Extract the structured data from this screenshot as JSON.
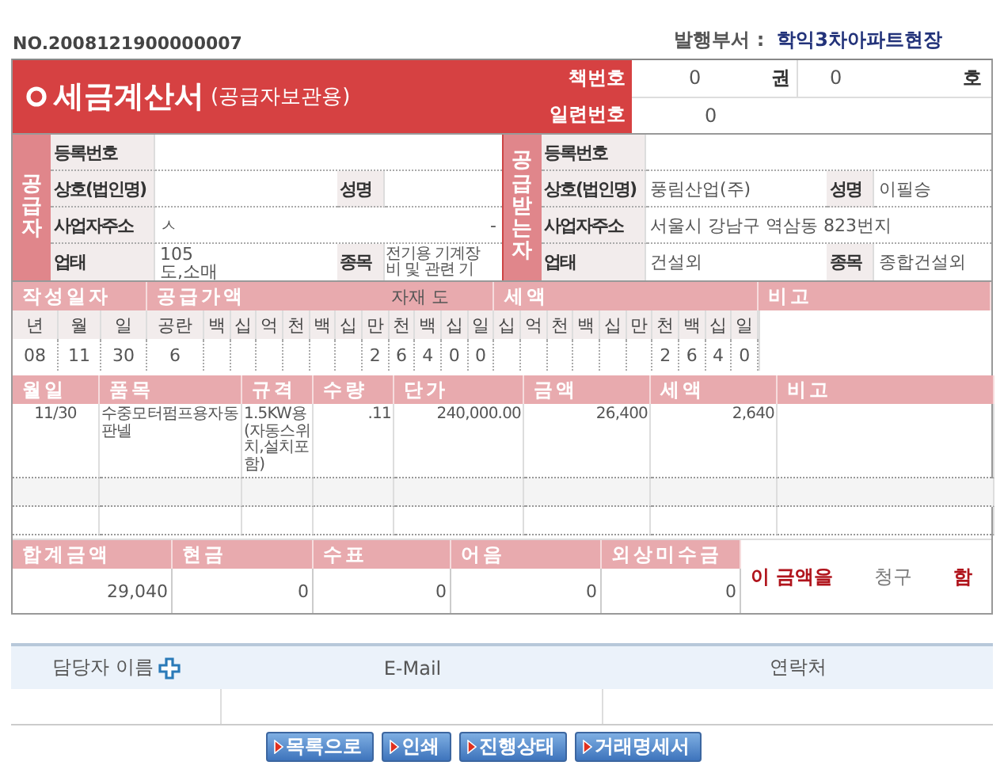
{
  "invoice_no": "NO.2008121900000007",
  "department": {
    "label": "발행부서 :",
    "value": "학익3차아파트현장"
  },
  "title": "세금계산서",
  "subtitle": "(공급자보관용)",
  "book": {
    "label": "책번호",
    "volume": "0",
    "volume_unit": "권",
    "number": "0",
    "number_unit": "호"
  },
  "serial": {
    "label": "일련번호",
    "value": "0"
  },
  "parties": [
    {
      "heading": "공급자",
      "rows": [
        {
          "label": "등록번호"
        },
        {
          "label": "상호(법인명)",
          "extra_label": "성명"
        },
        {
          "label": "사업자주소",
          "value": "ㅅ",
          "tail": "-"
        },
        {
          "label": "업태",
          "value": "105\n도,소매",
          "extra_label": "종목",
          "extra_value": "전기용 기계장\n비 및 관련 기"
        }
      ]
    },
    {
      "heading": "공급받는자",
      "rows": [
        {
          "label": "등록번호"
        },
        {
          "label": "상호(법인명)",
          "value": "풍림산업(주)",
          "extra_label": "성명",
          "extra_value": "이필승"
        },
        {
          "label": "사업자주소",
          "value": "서울시 강남구 역삼동 823번지"
        },
        {
          "label": "업태",
          "value": "건설외",
          "extra_label": "종목",
          "extra_value": "종합건설외"
        }
      ]
    }
  ],
  "summary_headers": {
    "date": "작성일자",
    "supply": "공급가액",
    "supply_note": "자재 도",
    "tax": "세액",
    "note": "비고"
  },
  "date_fields": [
    {
      "label": "년",
      "value": "08"
    },
    {
      "label": "월",
      "value": "11"
    },
    {
      "label": "일",
      "value": "30"
    },
    {
      "label": "공란",
      "value": "6"
    }
  ],
  "supply_digits": [
    {
      "label": "백"
    },
    {
      "label": "십"
    },
    {
      "label": "억"
    },
    {
      "label": "천"
    },
    {
      "label": "백"
    },
    {
      "label": "십"
    },
    {
      "label": "만",
      "value": "2"
    },
    {
      "label": "천",
      "value": "6"
    },
    {
      "label": "백",
      "value": "4"
    },
    {
      "label": "십",
      "value": "0"
    },
    {
      "label": "일",
      "value": "0"
    }
  ],
  "tax_digits": [
    {
      "label": "십"
    },
    {
      "label": "억"
    },
    {
      "label": "천"
    },
    {
      "label": "백"
    },
    {
      "label": "십"
    },
    {
      "label": "만"
    },
    {
      "label": "천",
      "value": "2"
    },
    {
      "label": "백",
      "value": "6"
    },
    {
      "label": "십",
      "value": "4"
    },
    {
      "label": "일",
      "value": "0"
    }
  ],
  "item_columns": [
    "월일",
    "품목",
    "규격",
    "수량",
    "단가",
    "금액",
    "세액",
    "비고"
  ],
  "items": [
    {
      "month_day": "11/30",
      "name": "수중모터펌프용자동판넬",
      "spec": "1.5KW용(자동스위치,설치포함)",
      "quantity": ".11",
      "unit_price": "240,000.00",
      "amount": "26,400",
      "tax": "2,640"
    }
  ],
  "total_columns": [
    "합계금액",
    "현금",
    "수표",
    "어음",
    "외상미수금"
  ],
  "total_values": [
    "29,040",
    "0",
    "0",
    "0",
    "0"
  ],
  "claim": {
    "lead": "이 금액을",
    "verb": "청구",
    "end": "함"
  },
  "contact_columns": [
    "담당자 이름",
    "E-Mail",
    "연락처"
  ],
  "buttons": [
    "목록으로",
    "인쇄",
    "진행상태",
    "거래명세서"
  ]
}
